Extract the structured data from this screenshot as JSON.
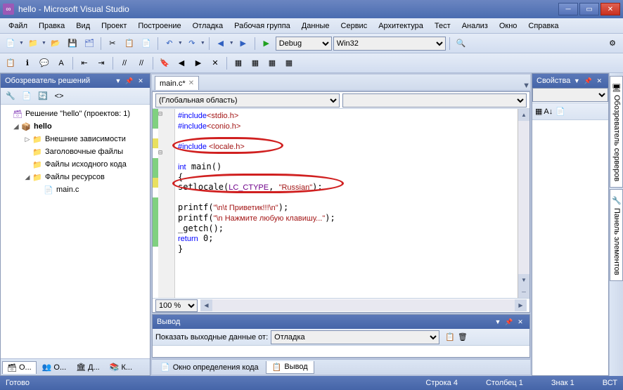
{
  "window": {
    "title": "hello - Microsoft Visual Studio"
  },
  "menu": [
    "Файл",
    "Правка",
    "Вид",
    "Проект",
    "Построение",
    "Отладка",
    "Рабочая группа",
    "Данные",
    "Сервис",
    "Архитектура",
    "Тест",
    "Анализ",
    "Окно",
    "Справка"
  ],
  "toolbar1": {
    "config": "Debug",
    "platform": "Win32"
  },
  "solution_explorer": {
    "title": "Обозреватель решений",
    "root": "Решение \"hello\" (проектов: 1)",
    "project": "hello",
    "folders": [
      "Внешние зависимости",
      "Заголовочные файлы",
      "Файлы исходного кода",
      "Файлы ресурсов"
    ],
    "file": "main.c",
    "tabs": {
      "active": "О...",
      "t2": "О...",
      "t3": "Д...",
      "t4": "К..."
    }
  },
  "editor": {
    "tab": "main.c*",
    "scope": "(Глобальная область)",
    "zoom": "100 %",
    "code_lines": [
      {
        "t": "#include",
        "a": "<stdio.h>",
        "cls": "inc"
      },
      {
        "t": "#include",
        "a": "<conio.h>",
        "cls": "inc"
      },
      {
        "t": "",
        "a": "",
        "cls": ""
      },
      {
        "t": "#include",
        "a": " <locale.h>",
        "cls": "inc ann1"
      },
      {
        "t": "",
        "a": "",
        "cls": ""
      },
      {
        "raw": "int main()",
        "cls": "sig"
      },
      {
        "raw": "{",
        "cls": ""
      },
      {
        "raw": "setlocale(LC_CTYPE, \"Russian\");",
        "cls": "ann2"
      },
      {
        "raw": "",
        "cls": ""
      },
      {
        "raw": "printf(\"\\n\\t Приветик!!!\\n\");",
        "cls": ""
      },
      {
        "raw": "printf(\"\\n Нажмите любую клавишу...\");",
        "cls": ""
      },
      {
        "raw": "_getch();",
        "cls": ""
      },
      {
        "raw": "return 0;",
        "cls": ""
      },
      {
        "raw": "}",
        "cls": ""
      }
    ]
  },
  "output": {
    "title": "Вывод",
    "show_from": "Показать выходные данные от:",
    "source": "Отладка",
    "tabs": {
      "t1": "Окно определения кода",
      "t2": "Вывод"
    }
  },
  "properties": {
    "title": "Свойства"
  },
  "side_tabs": [
    "Обозреватель серверов",
    "Панель элементов"
  ],
  "status": {
    "ready": "Готово",
    "line": "Строка 4",
    "col": "Столбец 1",
    "char": "Знак 1",
    "ins": "ВСТ"
  }
}
